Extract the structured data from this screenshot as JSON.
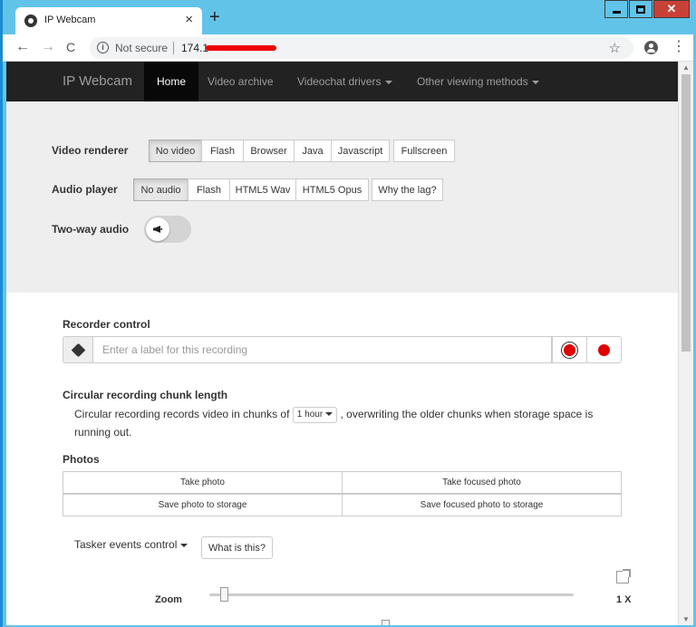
{
  "browser": {
    "tab_title": "IP Webcam",
    "tab_close": "×",
    "new_tab": "+",
    "secure_text": "Not secure",
    "url_visible": "174.1",
    "info_glyph": "i",
    "star_glyph": "☆",
    "back_glyph": "←",
    "forward_glyph": "→",
    "reload_glyph": "C",
    "menu_glyph": "⋮",
    "close_glyph": "✕"
  },
  "nav": {
    "brand": "IP Webcam",
    "items": [
      "Home",
      "Video archive",
      "Videochat drivers",
      "Other viewing methods"
    ]
  },
  "controls": {
    "video_renderer_label": "Video renderer",
    "video_renderer_options": [
      "No video",
      "Flash",
      "Browser",
      "Java",
      "Javascript"
    ],
    "video_fullscreen": "Fullscreen",
    "audio_player_label": "Audio player",
    "audio_player_options": [
      "No audio",
      "Flash",
      "HTML5 Wav",
      "HTML5 Opus"
    ],
    "why_lag": "Why the lag?",
    "two_way_audio_label": "Two-way audio"
  },
  "recorder": {
    "title": "Recorder control",
    "placeholder": "Enter a label for this recording"
  },
  "chunk": {
    "title": "Circular recording chunk length",
    "text_before": "Circular recording records video in chunks of",
    "dropdown": "1 hour",
    "text_after": ", overwriting the older chunks when storage space is",
    "text_line2": "running out."
  },
  "photos": {
    "title": "Photos",
    "take_photo": "Take photo",
    "take_focused": "Take focused photo",
    "save_photo": "Save photo to storage",
    "save_focused": "Save focused photo to storage"
  },
  "tasker": {
    "label": "Tasker events control",
    "help": "What is this?"
  },
  "zoom": {
    "label": "Zoom",
    "value": "1 X",
    "level": 0.02
  },
  "colors": {
    "titlebar": "#62c3e9",
    "navbar": "#222222",
    "record": "#e00000",
    "close": "#c94036"
  }
}
